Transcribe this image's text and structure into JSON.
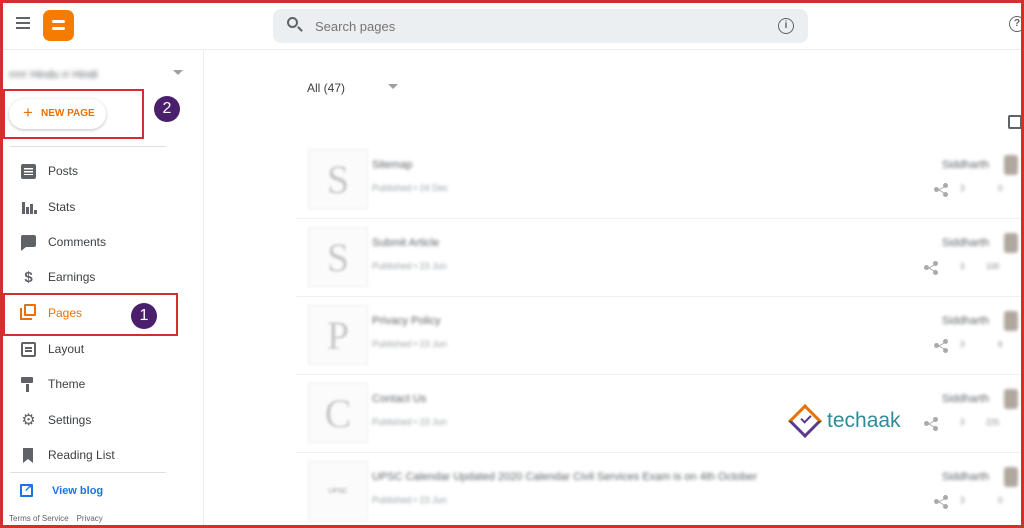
{
  "header": {
    "search_placeholder": "Search pages",
    "info_glyph": "i",
    "help_glyph": "?"
  },
  "sidebar": {
    "blog_name": "rrrrr Hindu rr Hindi",
    "new_page_label": "NEW PAGE",
    "items": [
      {
        "label": "Posts",
        "icon": "posts-icon"
      },
      {
        "label": "Stats",
        "icon": "stats-icon"
      },
      {
        "label": "Comments",
        "icon": "comments-icon"
      },
      {
        "label": "Earnings",
        "icon": "earnings-icon"
      },
      {
        "label": "Pages",
        "icon": "pages-icon",
        "active": true
      },
      {
        "label": "Layout",
        "icon": "layout-icon"
      },
      {
        "label": "Theme",
        "icon": "theme-icon"
      },
      {
        "label": "Settings",
        "icon": "settings-icon"
      },
      {
        "label": "Reading List",
        "icon": "reading-list-icon"
      }
    ],
    "view_blog_label": "View blog",
    "footer": {
      "terms": "Terms of Service",
      "privacy": "Privacy"
    }
  },
  "main": {
    "filter_label": "All (47)",
    "pages": [
      {
        "thumb": "S",
        "title": "Sitemap",
        "meta": "Published • 24 Dec",
        "author": "Siddharth",
        "views": "3",
        "count": "0"
      },
      {
        "thumb": "S",
        "title": "Submit Article",
        "meta": "Published • 23 Jun",
        "author": "Siddharth",
        "views": "3",
        "count": "100"
      },
      {
        "thumb": "P",
        "title": "Privacy Policy",
        "meta": "Published • 23 Jun",
        "author": "Siddharth",
        "views": "3",
        "count": "6"
      },
      {
        "thumb": "C",
        "title": "Contact Us",
        "meta": "Published • 23 Jun",
        "author": "Siddharth",
        "views": "3",
        "count": "225"
      },
      {
        "thumb": "UPSC",
        "title": "UPSC Calendar Updated 2020 Calendar Civil Services Exam is on 4th October",
        "meta": "Published • 23 Jun",
        "author": "Siddharth",
        "views": "3",
        "count": "0"
      }
    ]
  },
  "annotations": {
    "one": "1",
    "two": "2"
  },
  "watermark": {
    "text": "techaak"
  },
  "colors": {
    "accent": "#e8710a",
    "link": "#1a73e8",
    "annotation_border": "#d32f2f",
    "annotation_badge": "#4a1f6b"
  }
}
